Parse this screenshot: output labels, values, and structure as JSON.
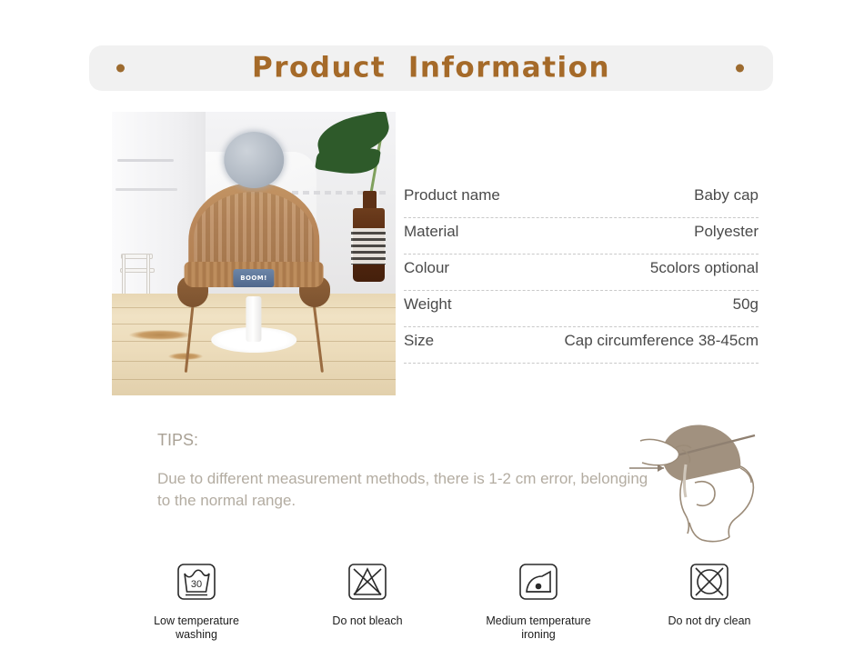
{
  "header": {
    "title": "Product  Information",
    "accent_color": "#a56a29",
    "banner_bg": "#f1f1f1",
    "dot_left_name": "decorative-dot-left",
    "dot_right_name": "decorative-dot-right"
  },
  "photo": {
    "alt": "Brown knit baby cap with grey pom-pom on white display stand",
    "brand_label": "BOOM!",
    "cap_color": "#b9875a",
    "pompom_color": "#b2bac4",
    "label_color": "#50688c"
  },
  "spec": {
    "rows": [
      {
        "key": "Product name",
        "value": "Baby cap"
      },
      {
        "key": "Material",
        "value": "Polyester"
      },
      {
        "key": "Colour",
        "value": "5colors optional"
      },
      {
        "key": "Weight",
        "value": "50g"
      },
      {
        "key": "Size",
        "value": "Cap circumference 38-45cm"
      }
    ]
  },
  "tips": {
    "title": "TIPS:",
    "body": "Due to different measurement methods, there is 1-2 cm error, belonging to the normal range.",
    "text_color": "#b3aca1",
    "illustration_name": "head-circumference-measure-illustration"
  },
  "care": {
    "items": [
      {
        "icon": "wash-tub-30-icon",
        "label": "Low temperature\nwashing",
        "temperature": "30"
      },
      {
        "icon": "do-not-bleach-icon",
        "label": "Do not bleach"
      },
      {
        "icon": "iron-one-dot-icon",
        "label": "Medium temperature\nironing"
      },
      {
        "icon": "do-not-dry-clean-icon",
        "label": "Do not dry clean"
      }
    ]
  }
}
